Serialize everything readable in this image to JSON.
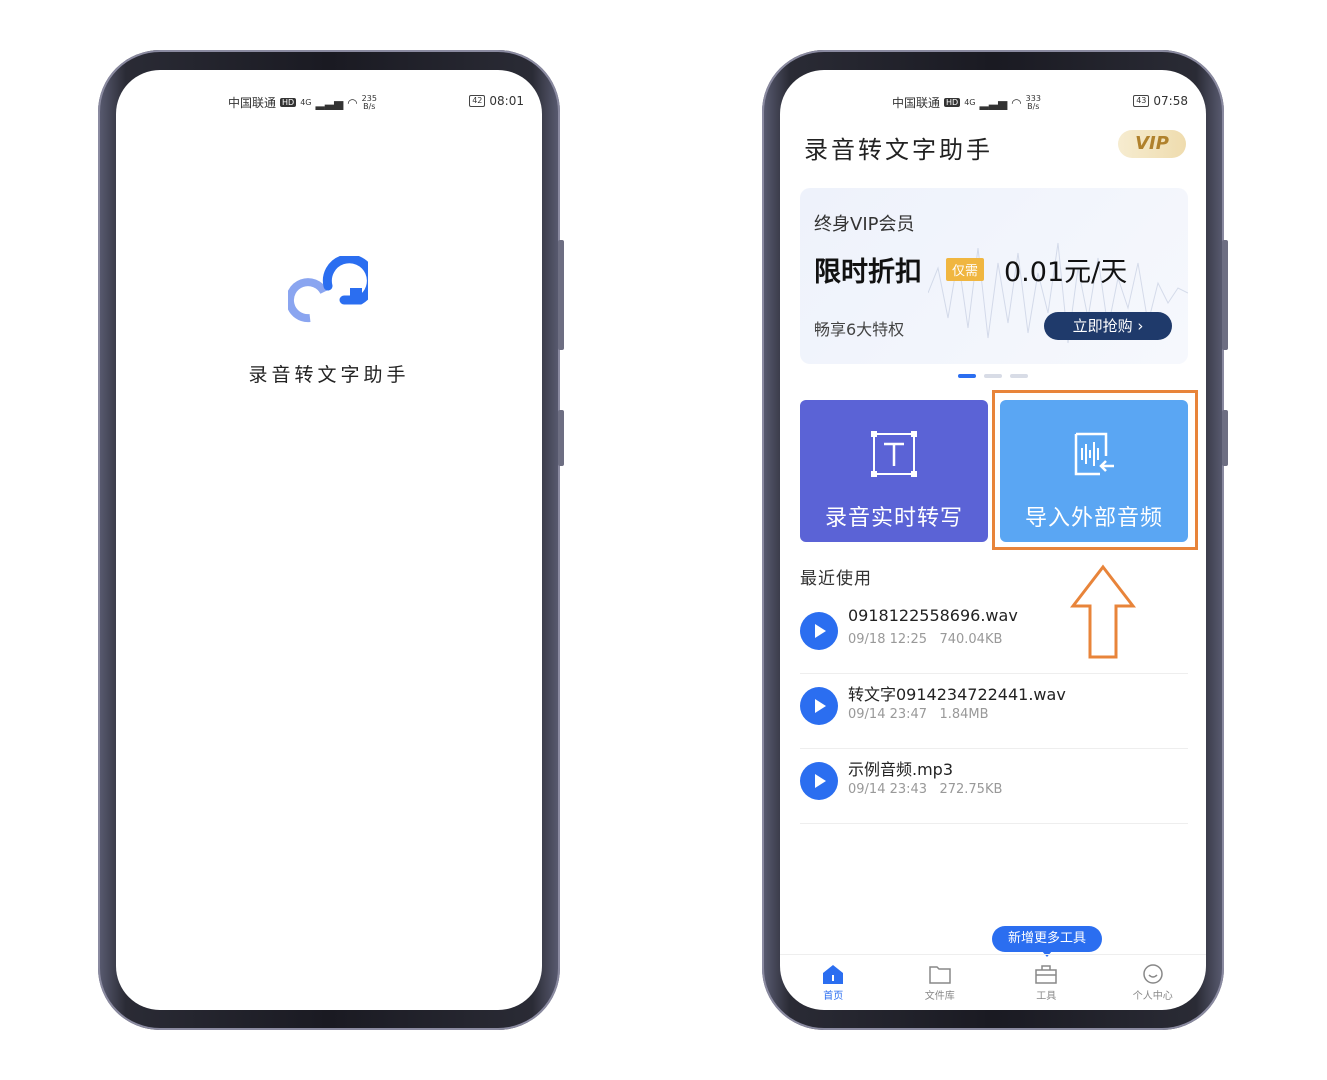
{
  "left_phone": {
    "status": {
      "carrier": "中国联通",
      "hd": "HD",
      "network": "4G",
      "speed_top": "235",
      "speed_bottom": "B/s",
      "battery": "42",
      "time": "08:01"
    },
    "app_name": "录音转文字助手"
  },
  "right_phone": {
    "status": {
      "carrier": "中国联通",
      "hd": "HD",
      "network": "4G",
      "speed_top": "333",
      "speed_bottom": "B/s",
      "battery": "43",
      "time": "07:58"
    },
    "header": {
      "title": "录音转文字助手",
      "vip_label": "VIP"
    },
    "banner": {
      "line1": "终身VIP会员",
      "line2": "限时折扣",
      "tag": "仅需",
      "price": "0.01元/天",
      "line3": "畅享6大特权",
      "buy_label": "立即抢购 ›"
    },
    "actions": {
      "record_label": "录音实时转写",
      "import_label": "导入外部音频"
    },
    "recent": {
      "title": "最近使用",
      "files": [
        {
          "name": "0918122558696.wav",
          "date": "09/18 12:25",
          "size": "740.04KB"
        },
        {
          "name": "转文字0914234722441.wav",
          "date": "09/14 23:47",
          "size": "1.84MB"
        },
        {
          "name": "示例音频.mp3",
          "date": "09/14 23:43",
          "size": "272.75KB"
        }
      ]
    },
    "tooltip": "新增更多工具",
    "tabs": [
      {
        "label": "首页",
        "icon": "home-icon"
      },
      {
        "label": "文件库",
        "icon": "folder-icon"
      },
      {
        "label": "工具",
        "icon": "toolbox-icon"
      },
      {
        "label": "个人中心",
        "icon": "smile-icon"
      }
    ],
    "colors": {
      "accent": "#2b6ef0",
      "record_card": "#5b63d6",
      "import_card": "#5aa6f3",
      "highlight": "#e8843a"
    }
  }
}
